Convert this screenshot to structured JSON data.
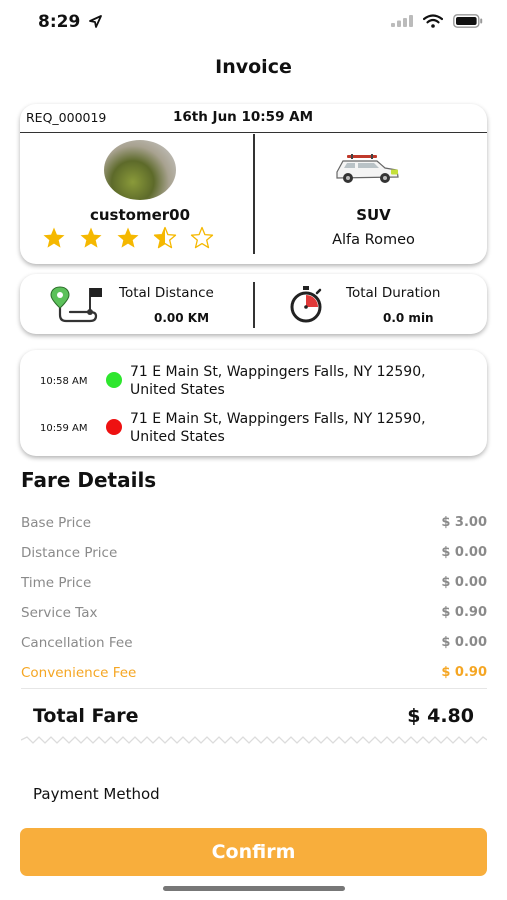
{
  "status_bar": {
    "time": "8:29"
  },
  "header": {
    "title": "Invoice"
  },
  "trip": {
    "request_id": "REQ_000019",
    "date": "16th Jun 10:59 AM",
    "customer": {
      "name": "customer00",
      "rating": 3.5,
      "max_rating": 5
    },
    "vehicle": {
      "type": "SUV",
      "model": "Alfa Romeo"
    },
    "distance": {
      "label": "Total Distance",
      "value": "0.00 KM"
    },
    "duration": {
      "label": "Total Duration",
      "value": "0.0 min"
    },
    "pickup": {
      "time": "10:58 AM",
      "address": "71 E Main St, Wappingers Falls, NY  12590, United States",
      "color": "#2ee62e"
    },
    "dropoff": {
      "time": "10:59 AM",
      "address": "71 E Main St, Wappingers Falls, NY  12590, United States",
      "color": "#ee1111"
    }
  },
  "fare": {
    "heading": "Fare Details",
    "rows": [
      {
        "label": "Base Price",
        "value": "$ 3.00"
      },
      {
        "label": "Distance Price",
        "value": "$ 0.00"
      },
      {
        "label": "Time Price",
        "value": "$ 0.00"
      },
      {
        "label": "Service Tax",
        "value": "$ 0.90"
      },
      {
        "label": "Cancellation Fee",
        "value": "$ 0.00"
      },
      {
        "label": "Convenience Fee",
        "value": "$ 0.90"
      }
    ],
    "total_label": "Total Fare",
    "total_value": "$ 4.80"
  },
  "payment": {
    "label": "Payment Method"
  },
  "actions": {
    "confirm_label": "Confirm"
  },
  "colors": {
    "accent": "#f8ae3c",
    "star": "#f5b800"
  }
}
